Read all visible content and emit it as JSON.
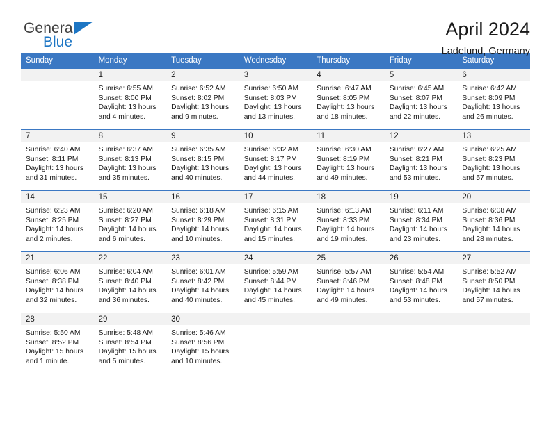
{
  "brand": {
    "word_general": "General",
    "word_blue": "Blue",
    "flag_color": "#1d76c4"
  },
  "header": {
    "title": "April 2024",
    "location": "Ladelund, Germany",
    "header_bg": "#3b78c3",
    "daynum_bg": "#f2f2f2"
  },
  "weekday_headers": [
    "Sunday",
    "Monday",
    "Tuesday",
    "Wednesday",
    "Thursday",
    "Friday",
    "Saturday"
  ],
  "labels": {
    "sunrise": "Sunrise:",
    "sunset": "Sunset:",
    "daylight": "Daylight:"
  },
  "weeks": [
    {
      "days": [
        {
          "day": "",
          "empty": true
        },
        {
          "day": "1",
          "sunrise": "Sunrise: 6:55 AM",
          "sunset": "Sunset: 8:00 PM",
          "daylight_1": "Daylight: 13 hours",
          "daylight_2": "and 4 minutes."
        },
        {
          "day": "2",
          "sunrise": "Sunrise: 6:52 AM",
          "sunset": "Sunset: 8:02 PM",
          "daylight_1": "Daylight: 13 hours",
          "daylight_2": "and 9 minutes."
        },
        {
          "day": "3",
          "sunrise": "Sunrise: 6:50 AM",
          "sunset": "Sunset: 8:03 PM",
          "daylight_1": "Daylight: 13 hours",
          "daylight_2": "and 13 minutes."
        },
        {
          "day": "4",
          "sunrise": "Sunrise: 6:47 AM",
          "sunset": "Sunset: 8:05 PM",
          "daylight_1": "Daylight: 13 hours",
          "daylight_2": "and 18 minutes."
        },
        {
          "day": "5",
          "sunrise": "Sunrise: 6:45 AM",
          "sunset": "Sunset: 8:07 PM",
          "daylight_1": "Daylight: 13 hours",
          "daylight_2": "and 22 minutes."
        },
        {
          "day": "6",
          "sunrise": "Sunrise: 6:42 AM",
          "sunset": "Sunset: 8:09 PM",
          "daylight_1": "Daylight: 13 hours",
          "daylight_2": "and 26 minutes."
        }
      ]
    },
    {
      "days": [
        {
          "day": "7",
          "sunrise": "Sunrise: 6:40 AM",
          "sunset": "Sunset: 8:11 PM",
          "daylight_1": "Daylight: 13 hours",
          "daylight_2": "and 31 minutes."
        },
        {
          "day": "8",
          "sunrise": "Sunrise: 6:37 AM",
          "sunset": "Sunset: 8:13 PM",
          "daylight_1": "Daylight: 13 hours",
          "daylight_2": "and 35 minutes."
        },
        {
          "day": "9",
          "sunrise": "Sunrise: 6:35 AM",
          "sunset": "Sunset: 8:15 PM",
          "daylight_1": "Daylight: 13 hours",
          "daylight_2": "and 40 minutes."
        },
        {
          "day": "10",
          "sunrise": "Sunrise: 6:32 AM",
          "sunset": "Sunset: 8:17 PM",
          "daylight_1": "Daylight: 13 hours",
          "daylight_2": "and 44 minutes."
        },
        {
          "day": "11",
          "sunrise": "Sunrise: 6:30 AM",
          "sunset": "Sunset: 8:19 PM",
          "daylight_1": "Daylight: 13 hours",
          "daylight_2": "and 49 minutes."
        },
        {
          "day": "12",
          "sunrise": "Sunrise: 6:27 AM",
          "sunset": "Sunset: 8:21 PM",
          "daylight_1": "Daylight: 13 hours",
          "daylight_2": "and 53 minutes."
        },
        {
          "day": "13",
          "sunrise": "Sunrise: 6:25 AM",
          "sunset": "Sunset: 8:23 PM",
          "daylight_1": "Daylight: 13 hours",
          "daylight_2": "and 57 minutes."
        }
      ]
    },
    {
      "days": [
        {
          "day": "14",
          "sunrise": "Sunrise: 6:23 AM",
          "sunset": "Sunset: 8:25 PM",
          "daylight_1": "Daylight: 14 hours",
          "daylight_2": "and 2 minutes."
        },
        {
          "day": "15",
          "sunrise": "Sunrise: 6:20 AM",
          "sunset": "Sunset: 8:27 PM",
          "daylight_1": "Daylight: 14 hours",
          "daylight_2": "and 6 minutes."
        },
        {
          "day": "16",
          "sunrise": "Sunrise: 6:18 AM",
          "sunset": "Sunset: 8:29 PM",
          "daylight_1": "Daylight: 14 hours",
          "daylight_2": "and 10 minutes."
        },
        {
          "day": "17",
          "sunrise": "Sunrise: 6:15 AM",
          "sunset": "Sunset: 8:31 PM",
          "daylight_1": "Daylight: 14 hours",
          "daylight_2": "and 15 minutes."
        },
        {
          "day": "18",
          "sunrise": "Sunrise: 6:13 AM",
          "sunset": "Sunset: 8:33 PM",
          "daylight_1": "Daylight: 14 hours",
          "daylight_2": "and 19 minutes."
        },
        {
          "day": "19",
          "sunrise": "Sunrise: 6:11 AM",
          "sunset": "Sunset: 8:34 PM",
          "daylight_1": "Daylight: 14 hours",
          "daylight_2": "and 23 minutes."
        },
        {
          "day": "20",
          "sunrise": "Sunrise: 6:08 AM",
          "sunset": "Sunset: 8:36 PM",
          "daylight_1": "Daylight: 14 hours",
          "daylight_2": "and 28 minutes."
        }
      ]
    },
    {
      "days": [
        {
          "day": "21",
          "sunrise": "Sunrise: 6:06 AM",
          "sunset": "Sunset: 8:38 PM",
          "daylight_1": "Daylight: 14 hours",
          "daylight_2": "and 32 minutes."
        },
        {
          "day": "22",
          "sunrise": "Sunrise: 6:04 AM",
          "sunset": "Sunset: 8:40 PM",
          "daylight_1": "Daylight: 14 hours",
          "daylight_2": "and 36 minutes."
        },
        {
          "day": "23",
          "sunrise": "Sunrise: 6:01 AM",
          "sunset": "Sunset: 8:42 PM",
          "daylight_1": "Daylight: 14 hours",
          "daylight_2": "and 40 minutes."
        },
        {
          "day": "24",
          "sunrise": "Sunrise: 5:59 AM",
          "sunset": "Sunset: 8:44 PM",
          "daylight_1": "Daylight: 14 hours",
          "daylight_2": "and 45 minutes."
        },
        {
          "day": "25",
          "sunrise": "Sunrise: 5:57 AM",
          "sunset": "Sunset: 8:46 PM",
          "daylight_1": "Daylight: 14 hours",
          "daylight_2": "and 49 minutes."
        },
        {
          "day": "26",
          "sunrise": "Sunrise: 5:54 AM",
          "sunset": "Sunset: 8:48 PM",
          "daylight_1": "Daylight: 14 hours",
          "daylight_2": "and 53 minutes."
        },
        {
          "day": "27",
          "sunrise": "Sunrise: 5:52 AM",
          "sunset": "Sunset: 8:50 PM",
          "daylight_1": "Daylight: 14 hours",
          "daylight_2": "and 57 minutes."
        }
      ]
    },
    {
      "days": [
        {
          "day": "28",
          "sunrise": "Sunrise: 5:50 AM",
          "sunset": "Sunset: 8:52 PM",
          "daylight_1": "Daylight: 15 hours",
          "daylight_2": "and 1 minute."
        },
        {
          "day": "29",
          "sunrise": "Sunrise: 5:48 AM",
          "sunset": "Sunset: 8:54 PM",
          "daylight_1": "Daylight: 15 hours",
          "daylight_2": "and 5 minutes."
        },
        {
          "day": "30",
          "sunrise": "Sunrise: 5:46 AM",
          "sunset": "Sunset: 8:56 PM",
          "daylight_1": "Daylight: 15 hours",
          "daylight_2": "and 10 minutes."
        },
        {
          "day": "",
          "empty": true
        },
        {
          "day": "",
          "empty": true
        },
        {
          "day": "",
          "empty": true
        },
        {
          "day": "",
          "empty": true
        }
      ]
    }
  ]
}
